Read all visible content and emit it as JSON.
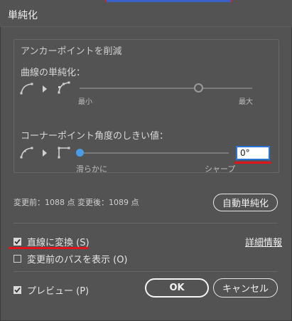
{
  "window": {
    "title": "単純化"
  },
  "anchor_group": {
    "title": "アンカーポイントを削減",
    "curve_label": "曲線の単純化：",
    "curve_slider": {
      "min_label": "最小",
      "max_label": "最大",
      "value_fraction": 0.69
    },
    "corner_label": "コーナーポイント角度のしきい値：",
    "corner_slider": {
      "min_label": "滑らかに",
      "max_label": "シャープ",
      "value_fraction": 0.0
    },
    "angle_value": "0°"
  },
  "stats": {
    "text": "変更前：1088 点 変更後：1089 点"
  },
  "auto_simplify_button": "自動単純化",
  "options": {
    "straight_lines": {
      "label": "直線に変換 (S)",
      "checked": true
    },
    "show_original": {
      "label": "変更前のパスを表示 (O)",
      "checked": false
    },
    "preview": {
      "label": "プレビュー (P)",
      "checked": true
    }
  },
  "details_link": "詳細情報",
  "buttons": {
    "ok": "OK",
    "cancel": "キャンセル"
  },
  "colors": {
    "background": "#535353",
    "accent_blue": "#4a9be8",
    "annotation_red": "#e0141b"
  }
}
